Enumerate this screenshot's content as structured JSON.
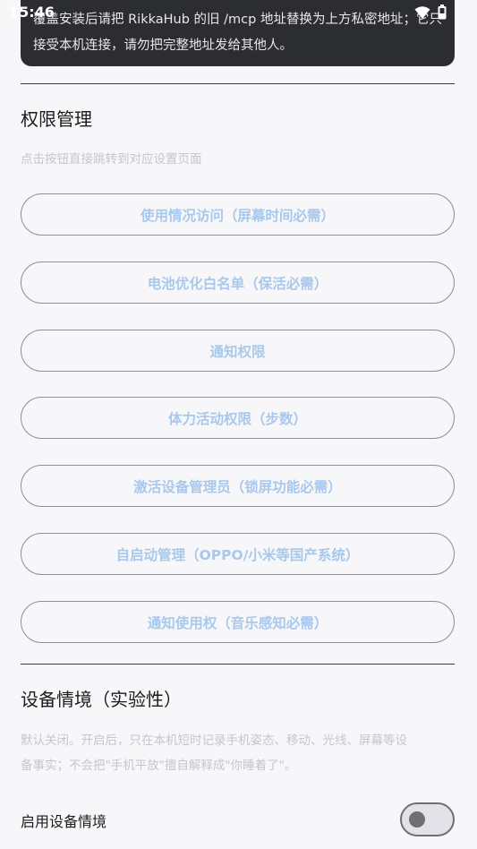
{
  "status_bar": {
    "time": "15:46",
    "icons": [
      "wifi-icon",
      "battery-icon"
    ]
  },
  "toast": {
    "line1": "覆盖安装后请把 RikkaHub 的旧 /mcp 地址替换为上方私密地址；它只",
    "line2": "接受本机连接，请勿把完整地址发给其他人。"
  },
  "permissions": {
    "title": "权限管理",
    "description": "点击按钮直接跳转到对应设置页面",
    "buttons": [
      {
        "label": "使用情况访问（屏幕时间必需）"
      },
      {
        "label": "电池优化白名单（保活必需）"
      },
      {
        "label": "通知权限"
      },
      {
        "label": "体力活动权限（步数）"
      },
      {
        "label": "激活设备管理员（锁屏功能必需）"
      },
      {
        "label": "自启动管理（OPPO/小米等国产系统）"
      },
      {
        "label": "通知使用权（音乐感知必需）"
      }
    ]
  },
  "device_context": {
    "title": "设备情境（实验性）",
    "description_line1": "默认关闭。开启后，只在本机短时记录手机姿态、移动、光线、屏幕等设",
    "description_line2": "备事实；不会把\"手机平放\"擅自解释成\"你睡着了\"。",
    "toggle_label": "启用设备情境",
    "toggle_on": false
  },
  "colors": {
    "accent_text": "#a8c8ec",
    "toast_bg": "#2c2d31",
    "background": "#f7f7f9"
  }
}
